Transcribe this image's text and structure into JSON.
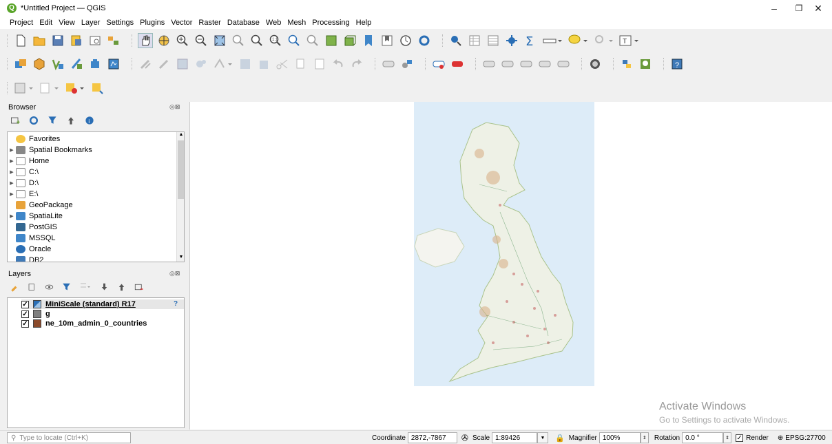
{
  "window": {
    "title": "*Untitled Project — QGIS"
  },
  "menu": [
    "Project",
    "Edit",
    "View",
    "Layer",
    "Settings",
    "Plugins",
    "Vector",
    "Raster",
    "Database",
    "Web",
    "Mesh",
    "Processing",
    "Help"
  ],
  "browser": {
    "title": "Browser",
    "items": [
      {
        "label": "Favorites",
        "icon": "star-icon",
        "expand": false
      },
      {
        "label": "Spatial Bookmarks",
        "icon": "bookmark-icon",
        "expand": true
      },
      {
        "label": "Home",
        "icon": "home-folder-icon",
        "expand": true
      },
      {
        "label": "C:\\",
        "icon": "drive-icon",
        "expand": true
      },
      {
        "label": "D:\\",
        "icon": "drive-icon",
        "expand": true
      },
      {
        "label": "E:\\",
        "icon": "drive-icon",
        "expand": true
      },
      {
        "label": "GeoPackage",
        "icon": "geopackage-icon",
        "expand": false
      },
      {
        "label": "SpatiaLite",
        "icon": "spatialite-icon",
        "expand": true
      },
      {
        "label": "PostGIS",
        "icon": "postgis-icon",
        "expand": false
      },
      {
        "label": "MSSQL",
        "icon": "mssql-icon",
        "expand": false
      },
      {
        "label": "Oracle",
        "icon": "oracle-icon",
        "expand": false
      },
      {
        "label": "DB2",
        "icon": "db2-icon",
        "expand": false
      }
    ]
  },
  "layers": {
    "title": "Layers",
    "items": [
      {
        "label": "MiniScale (standard) R17",
        "checked": true,
        "swatch": "raster",
        "underline": true
      },
      {
        "label": "g",
        "checked": true,
        "swatch": "#7f7f7f",
        "underline": false
      },
      {
        "label": "ne_10m_admin_0_countries",
        "checked": true,
        "swatch": "#8b4a2b",
        "underline": false
      }
    ]
  },
  "watermark": {
    "line1": "Activate Windows",
    "line2": "Go to Settings to activate Windows."
  },
  "status": {
    "locator_placeholder": "Type to locate (Ctrl+K)",
    "coordinate_label": "Coordinate",
    "coordinate_value": "2872,-7867",
    "scale_label": "Scale",
    "scale_value": "1:89426",
    "magnifier_label": "Magnifier",
    "magnifier_value": "100%",
    "rotation_label": "Rotation",
    "rotation_value": "0.0 °",
    "render_label": "Render",
    "crs": "EPSG:27700"
  }
}
